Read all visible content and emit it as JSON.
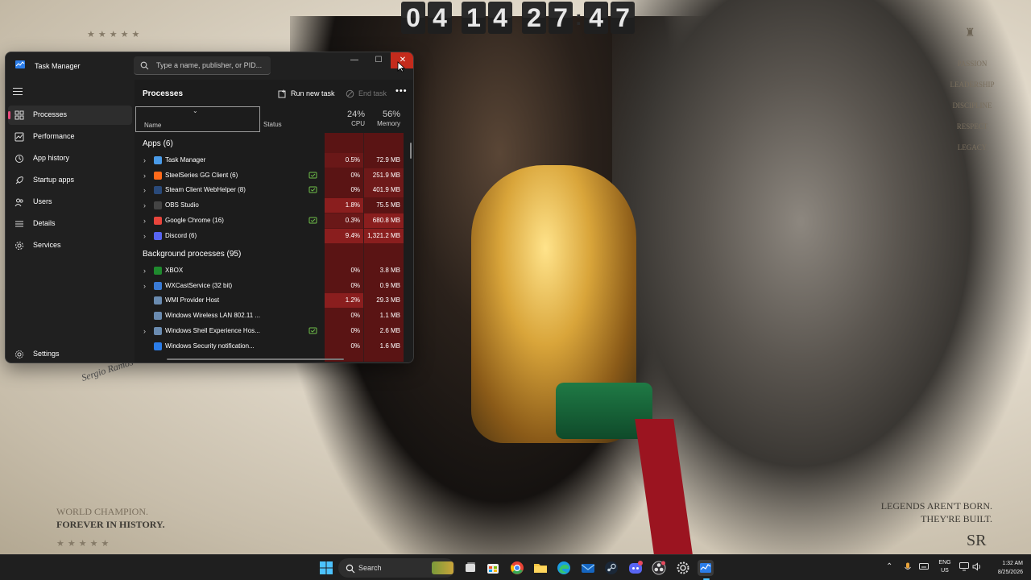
{
  "desktop": {
    "clock_digits": [
      "0",
      "4",
      "1",
      "4",
      "2",
      "7",
      "4",
      "7"
    ],
    "clock_separator": ":",
    "stars": "★★★★★",
    "tagline_line1": "WORLD CHAMPION.",
    "tagline_line2": "FOREVER IN HISTORY.",
    "legends_line1": "LEGENDS AREN'T BORN.",
    "legends_line2": "THEY'RE BUILT.",
    "virtues": [
      "PASSION",
      "LEADERSHIP",
      "DISCIPLINE",
      "RESPECT",
      "LEGACY"
    ],
    "signature": "Sergio Ramos",
    "monogram": "SR"
  },
  "window": {
    "title": "Task Manager",
    "search_placeholder": "Type a name, publisher, or PID...",
    "controls": {
      "minimize": "—",
      "maximize": "☐",
      "close": "✕"
    }
  },
  "sidebar": {
    "items": [
      {
        "label": "Processes",
        "icon": "processes-icon"
      },
      {
        "label": "Performance",
        "icon": "performance-icon"
      },
      {
        "label": "App history",
        "icon": "app-history-icon"
      },
      {
        "label": "Startup apps",
        "icon": "startup-apps-icon"
      },
      {
        "label": "Users",
        "icon": "users-icon"
      },
      {
        "label": "Details",
        "icon": "details-icon"
      },
      {
        "label": "Services",
        "icon": "services-icon"
      }
    ],
    "settings_label": "Settings"
  },
  "main": {
    "title": "Processes",
    "run_new_task": "Run new task",
    "end_task": "End task",
    "columns": {
      "name": "Name",
      "status": "Status",
      "cpu_pct": "24%",
      "cpu_label": "CPU",
      "mem_pct": "56%",
      "mem_label": "Memory"
    },
    "apps_group": "Apps (6)",
    "apps": [
      {
        "name": "Task Manager",
        "cpu": "0.5%",
        "mem": "72.9 MB",
        "expandable": true,
        "status_icon": false,
        "color": "#4a9be8"
      },
      {
        "name": "SteelSeries GG Client (6)",
        "cpu": "0%",
        "mem": "251.9 MB",
        "expandable": true,
        "status_icon": true,
        "color": "#ff6a1a"
      },
      {
        "name": "Steam Client WebHelper (8)",
        "cpu": "0%",
        "mem": "401.9 MB",
        "expandable": true,
        "status_icon": true,
        "color": "#2a4a7a"
      },
      {
        "name": "OBS Studio",
        "cpu": "1.8%",
        "mem": "75.5 MB",
        "expandable": true,
        "status_icon": false,
        "color": "#444444"
      },
      {
        "name": "Google Chrome (16)",
        "cpu": "0.3%",
        "mem": "680.8 MB",
        "expandable": true,
        "status_icon": true,
        "color": "#e8453c"
      },
      {
        "name": "Discord (6)",
        "cpu": "9.4%",
        "mem": "1,321.2 MB",
        "expandable": true,
        "status_icon": false,
        "color": "#5865f2"
      }
    ],
    "background_group": "Background processes (95)",
    "background": [
      {
        "name": "XBOX",
        "cpu": "0%",
        "mem": "3.8 MB",
        "expandable": true,
        "status_icon": false,
        "color": "#1f8a2e"
      },
      {
        "name": "WXCastService (32 bit)",
        "cpu": "0%",
        "mem": "0.9 MB",
        "expandable": true,
        "status_icon": false,
        "color": "#3a7bd5"
      },
      {
        "name": "WMI Provider Host",
        "cpu": "1.2%",
        "mem": "29.3 MB",
        "expandable": false,
        "status_icon": false,
        "color": "#6a8bb0"
      },
      {
        "name": "Windows Wireless LAN 802.11 ...",
        "cpu": "0%",
        "mem": "1.1 MB",
        "expandable": false,
        "status_icon": false,
        "color": "#6a8bb0"
      },
      {
        "name": "Windows Shell Experience Hos...",
        "cpu": "0%",
        "mem": "2.6 MB",
        "expandable": true,
        "status_icon": true,
        "color": "#6a8bb0"
      },
      {
        "name": "Windows Security notification...",
        "cpu": "0%",
        "mem": "1.6 MB",
        "expandable": false,
        "status_icon": false,
        "color": "#2b7de9"
      }
    ]
  },
  "taskbar": {
    "search_label": "Search",
    "lang_line1": "ENG",
    "lang_line2": "US",
    "time": "1:32 AM",
    "date": "8/25/2026"
  }
}
